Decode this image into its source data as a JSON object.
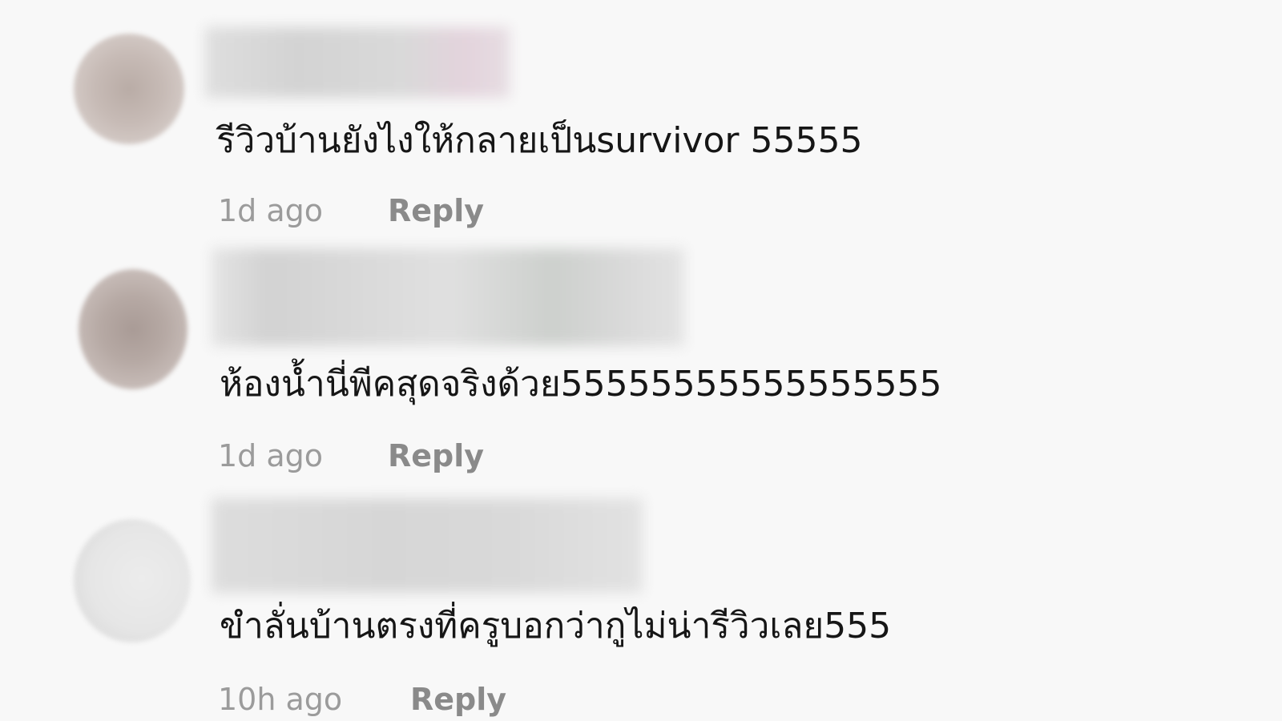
{
  "comments": [
    {
      "text": "รีวิวบ้านยังไงให้กลายเป็นsurvivor 55555",
      "time": "1d ago",
      "reply_label": "Reply"
    },
    {
      "text": "ห้องน้ำนี่พีคสุดจริงด้วย55555555555555555",
      "time": "1d ago",
      "reply_label": "Reply"
    },
    {
      "text": "ขำลั่นบ้านตรงที่ครูบอกว่ากูไม่น่ารีวิวเลย555",
      "time": "10h ago",
      "reply_label": "Reply"
    }
  ]
}
